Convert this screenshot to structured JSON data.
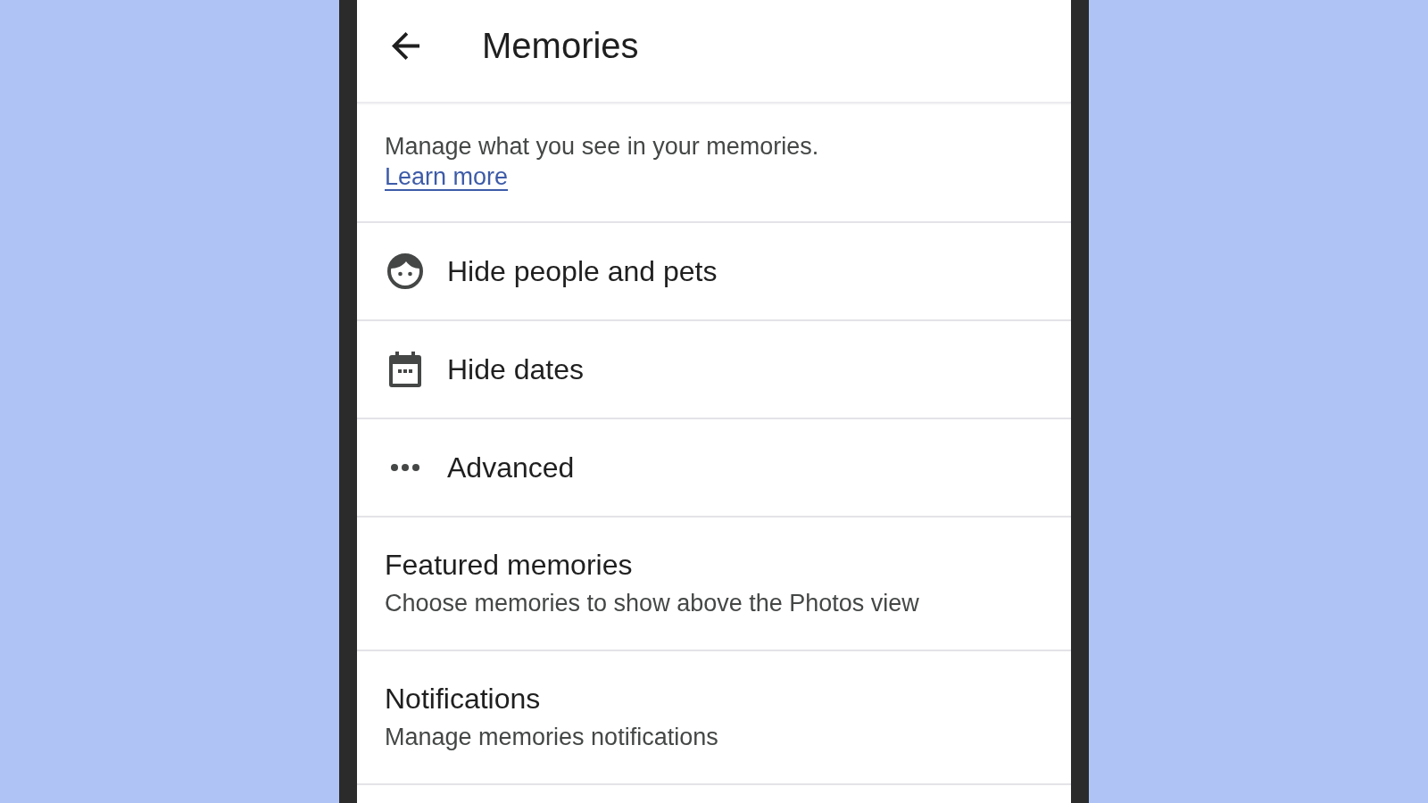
{
  "app_bar": {
    "title": "Memories"
  },
  "intro": {
    "text": "Manage what you see in your memories.",
    "link": "Learn more"
  },
  "hide_options": [
    {
      "label": "Hide people and pets"
    },
    {
      "label": "Hide dates"
    },
    {
      "label": "Advanced"
    }
  ],
  "settings": [
    {
      "title": "Featured memories",
      "subtitle": "Choose memories to show above the Photos view"
    },
    {
      "title": "Notifications",
      "subtitle": "Manage memories notifications"
    }
  ]
}
